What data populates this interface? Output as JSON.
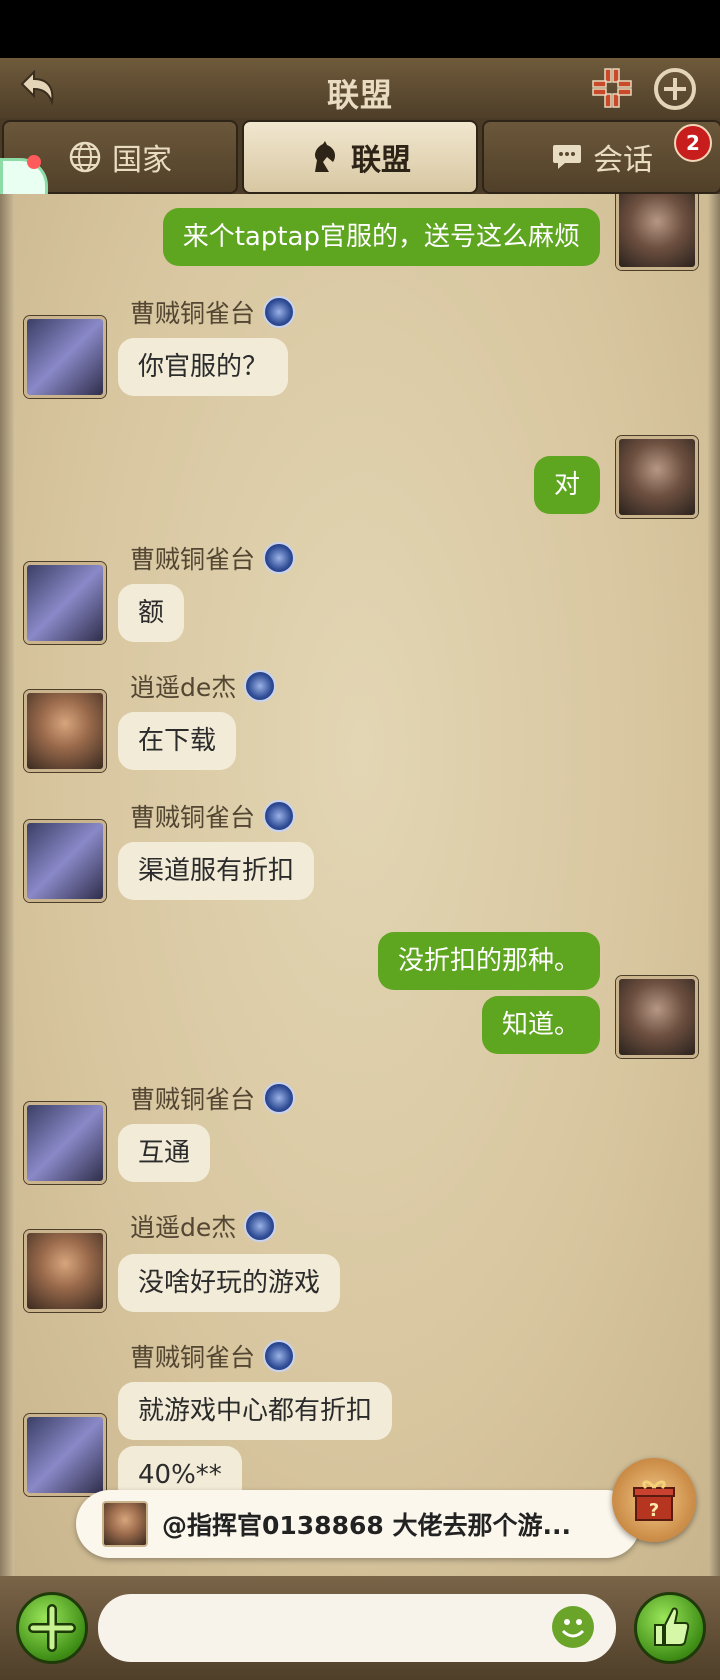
{
  "header": {
    "title": "联盟"
  },
  "tabs": [
    {
      "label": "国家",
      "icon": "globe-icon"
    },
    {
      "label": "联盟",
      "icon": "knight-icon",
      "active": true
    },
    {
      "label": "会话",
      "icon": "chat-icon",
      "badge": "2"
    }
  ],
  "messages": [
    {
      "side": "out",
      "text": "来个taptap官服的，送号这么麻烦"
    },
    {
      "side": "in",
      "sender": "曹贼铜雀台",
      "text": "你官服的？"
    },
    {
      "side": "out",
      "text": "对"
    },
    {
      "side": "in",
      "sender": "曹贼铜雀台",
      "text": "额"
    },
    {
      "side": "in",
      "sender": "逍遥de杰",
      "text": "在下载"
    },
    {
      "side": "in",
      "sender": "曹贼铜雀台",
      "text": "渠道服有折扣"
    },
    {
      "side": "out",
      "text": "没折扣的那种。"
    },
    {
      "side": "out",
      "text": "知道。"
    },
    {
      "side": "in",
      "sender": "曹贼铜雀台",
      "text": "互通"
    },
    {
      "side": "in",
      "sender": "逍遥de杰",
      "text": "没啥好玩的游戏"
    },
    {
      "side": "in",
      "sender": "曹贼铜雀台",
      "text": "就游戏中心都有折扣"
    },
    {
      "side": "in",
      "text": "40%**"
    }
  ],
  "notification": {
    "text": "@指挥官0138868 大佬去那个游..."
  },
  "input": {
    "placeholder": ""
  },
  "colors": {
    "outgoing_bubble": "#5ea520",
    "incoming_bubble": "#f2ebd7",
    "header_bg": "#5e4b32"
  }
}
